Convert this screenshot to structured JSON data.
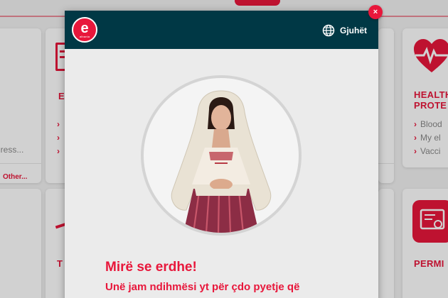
{
  "background": {
    "cards": [
      {
        "title": "",
        "items": [
          "dress..."
        ],
        "link": "Other..."
      },
      {
        "title": "E",
        "items": [
          "",
          "",
          ""
        ],
        "link": ""
      },
      {
        "title": "HEALTH PROTE",
        "items": [
          "Blood",
          "My el",
          "Vacci"
        ],
        "link": ""
      },
      {
        "title": "T",
        "items": [],
        "link": ""
      },
      {
        "title": "PERMI",
        "items": [],
        "link": ""
      }
    ],
    "colors": {
      "accent": "#e8173b",
      "card": "#ffffff",
      "page": "#f2f2f2"
    }
  },
  "modal": {
    "logo": {
      "letter": "e",
      "sub": "albania",
      "icon": "e-albania-logo"
    },
    "language_label": "Gjuhët",
    "language_icon": "globe-icon",
    "close_label": "×",
    "avatar_icon": "assistant-avatar",
    "welcome_title": "Mirë se erdhe!",
    "welcome_text": "Unë jam ndihmësi yt për çdo pyetje që",
    "colors": {
      "header": "#003845",
      "body": "#ebebeb",
      "accent": "#e8173b"
    }
  }
}
